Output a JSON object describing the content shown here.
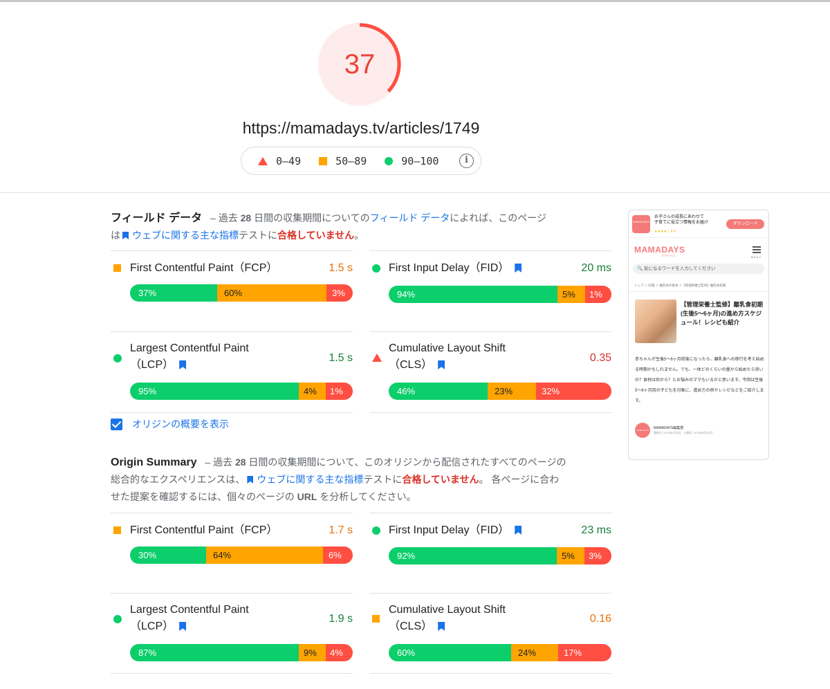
{
  "score": {
    "value": "37",
    "fraction": 0.37,
    "color": "#ff4e42"
  },
  "url": "https://mamadays.tv/articles/1749",
  "legend": [
    {
      "icon": "triangle-icon",
      "label": "0–49"
    },
    {
      "icon": "square-icon",
      "label": "50–89"
    },
    {
      "icon": "circle-icon",
      "label": "90–100"
    }
  ],
  "field": {
    "heading": "フィールド データ",
    "text1": "– 過去",
    "days": "28",
    "text2": "日間の収集期間についての",
    "link": "フィールド データ",
    "text3": "によれば、このページ",
    "text4": "は",
    "cwv_link": "ウェブに関する主な指標",
    "text5": "テストに",
    "fail": "合格していません",
    "text6": "。",
    "metrics": {
      "fcp": {
        "name": "First Contentful Paint（FCP）",
        "value": "1.5 s",
        "good": "37%",
        "avg": "60%",
        "poor": "3%"
      },
      "fid": {
        "name": "First Input Delay（FID）",
        "value": "20 ms",
        "good": "94%",
        "avg": "5%",
        "poor": "1%"
      },
      "lcp": {
        "name1": "Largest Contentful Paint",
        "name2": "（LCP）",
        "value": "1.5 s",
        "good": "95%",
        "avg": "4%",
        "poor": "1%"
      },
      "cls": {
        "name1": "Cumulative Layout Shift",
        "name2": "（CLS）",
        "value": "0.35",
        "good": "46%",
        "avg": "23%",
        "poor": "32%"
      }
    }
  },
  "origin_checkbox_label": "オリジンの概要を表示",
  "origin": {
    "heading": "Origin Summary",
    "text1": "– 過去",
    "days": "28",
    "text2": "日間の収集期間について、このオリジンから配信されたすべてのページの",
    "text3": "総合的なエクスペリエンスは、",
    "cwv_link": "ウェブに関する主な指標",
    "text4": "テストに",
    "fail": "合格していません",
    "text5": "。 各ページに合わ",
    "text6": "せた提案を確認するには、個々のページの",
    "url_word": "URL",
    "text7": "を分析してください。",
    "metrics": {
      "fcp": {
        "name": "First Contentful Paint（FCP）",
        "value": "1.7 s",
        "good": "30%",
        "avg": "64%",
        "poor": "6%"
      },
      "fid": {
        "name": "First Input Delay（FID）",
        "value": "23 ms",
        "good": "92%",
        "avg": "5%",
        "poor": "3%"
      },
      "lcp": {
        "name1": "Largest Contentful Paint",
        "name2": "（LCP）",
        "value": "1.9 s",
        "good": "87%",
        "avg": "9%",
        "poor": "4%"
      },
      "cls": {
        "name1": "Cumulative Layout Shift",
        "name2": "（CLS）",
        "value": "0.16",
        "good": "60%",
        "avg": "24%",
        "poor": "17%"
      }
    }
  },
  "phone": {
    "banner_icon": "MAMA DAYS",
    "banner_line1": "お子さんの成長にあわせて",
    "banner_line2": "子育てに役立つ情報をお届け",
    "banner_rating": "★★★★☆ 4.4",
    "download": "ダウンロード",
    "logo": "MAMADAYS",
    "logo_sub": "ママデイズ",
    "menu_label": "メニュー",
    "search_placeholder": "🔍 気になるワードを入力してください",
    "breadcrumb": "トップ ＞ 料理 ＞ 離乳食の基本 ＞【管理栄養士監修】離乳食初期",
    "title": "【管理栄養士監修】離乳食初期(生後5～6ヶ月)の進め方スケジュール！レシピも紹介",
    "body": "赤ちゃんが生後5～6ヶ月前後になったら、離乳食への移行を考え始める時期かもしれません。でも、一体どのくらいの量から始めたら良いの？食材は何から？とお悩みのママもいるかと思います。今回は生後5～6ヶ月目の子どもを対象に、進め方の例やレシピなどをご紹介します。",
    "avatar": "MAMA DAYS",
    "author": "MAMADAYS編集部",
    "dates": "更新日: 2020年3月5日　公開日: 2019年6月26日"
  }
}
